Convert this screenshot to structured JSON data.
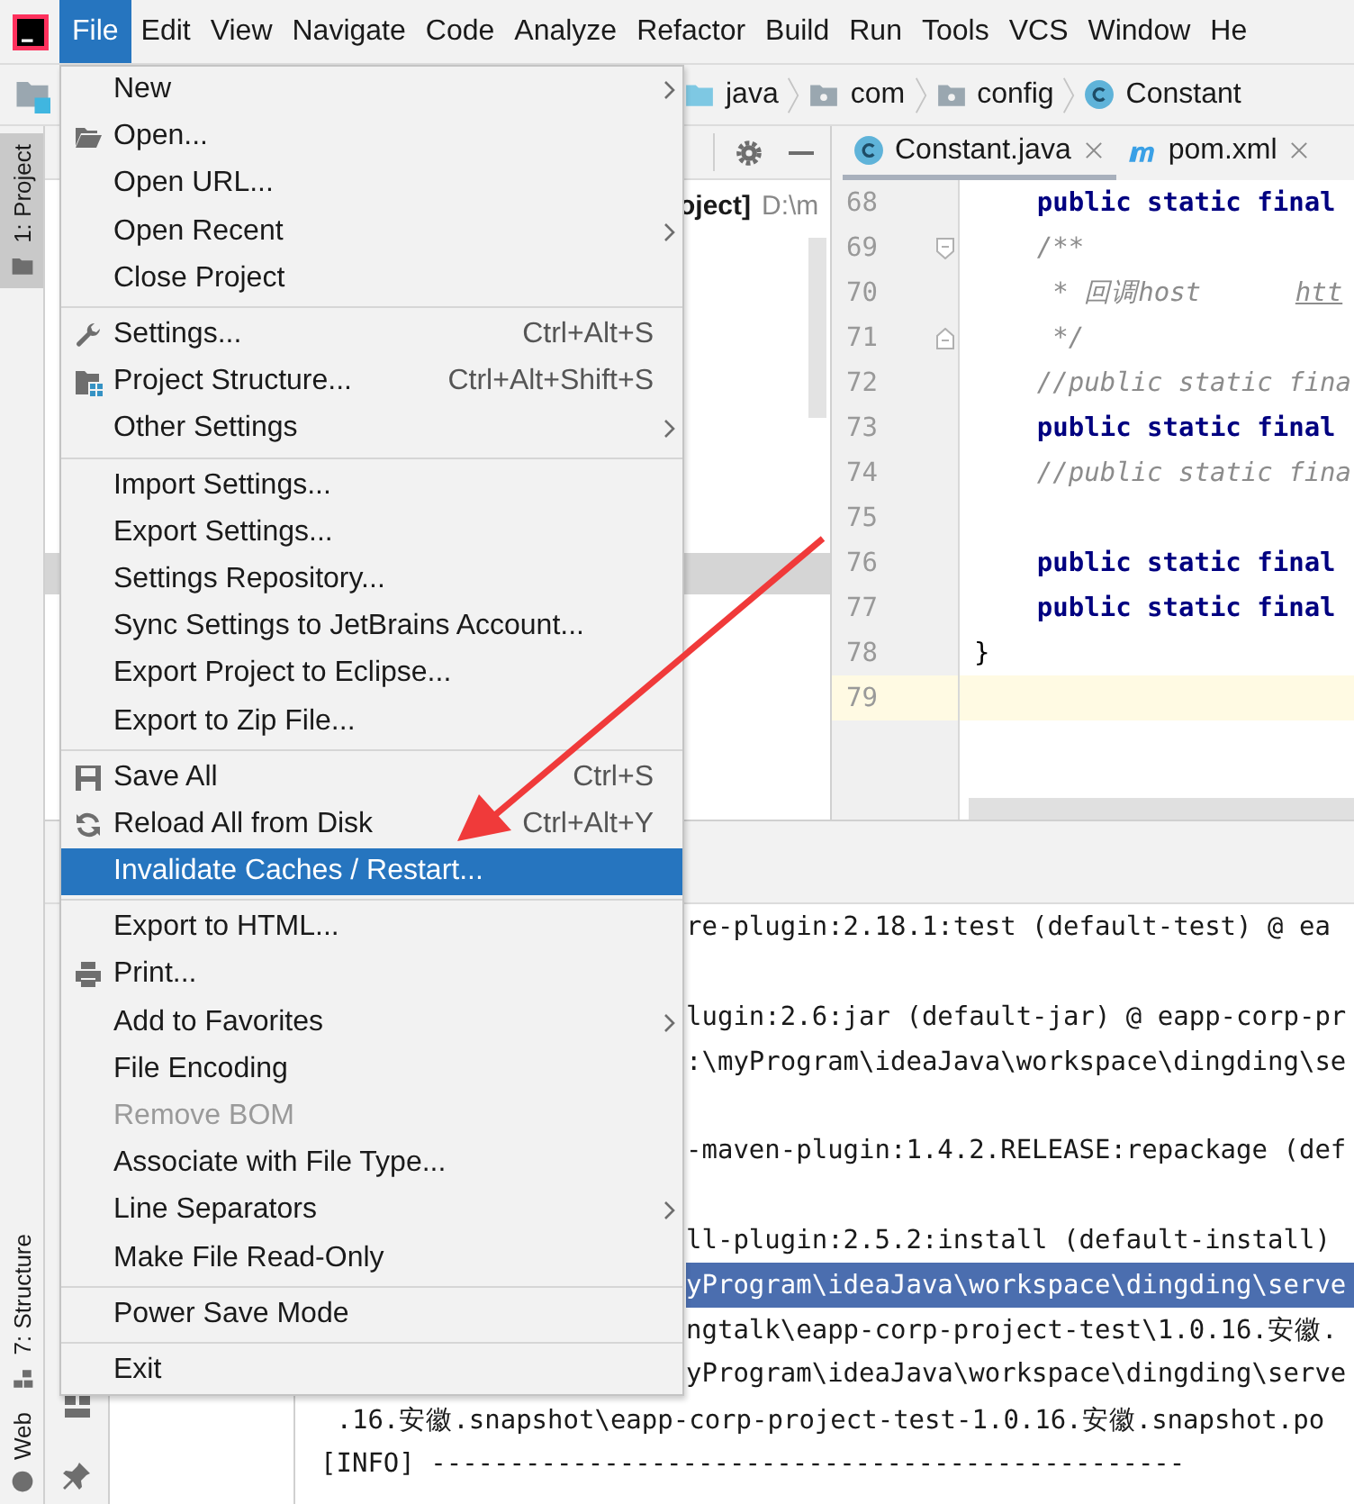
{
  "menubar": [
    {
      "label": "File",
      "selected": true
    },
    {
      "label": "Edit",
      "selected": false
    },
    {
      "label": "View",
      "selected": false
    },
    {
      "label": "Navigate",
      "selected": false
    },
    {
      "label": "Code",
      "selected": false
    },
    {
      "label": "Analyze",
      "selected": false
    },
    {
      "label": "Refactor",
      "selected": false
    },
    {
      "label": "Build",
      "selected": false
    },
    {
      "label": "Run",
      "selected": false
    },
    {
      "label": "Tools",
      "selected": false
    },
    {
      "label": "VCS",
      "selected": false
    },
    {
      "label": "Window",
      "selected": false
    },
    {
      "label": "He",
      "selected": false
    }
  ],
  "breadcrumb": [
    {
      "label": "java",
      "kind": "source-folder"
    },
    {
      "label": "com",
      "kind": "package"
    },
    {
      "label": "config",
      "kind": "package"
    },
    {
      "label": "Constant",
      "kind": "class"
    }
  ],
  "tool_stripes": [
    {
      "label": "1: Project",
      "kind": "project",
      "selected": true
    },
    {
      "label": "7: Structure",
      "kind": "structure",
      "selected": false
    },
    {
      "label": "Web",
      "kind": "web",
      "selected": false
    }
  ],
  "project_panel": {
    "root_name": "oject]",
    "root_path": "D:\\m"
  },
  "editor": {
    "tabs": [
      {
        "label": "Constant.java",
        "kind": "class",
        "selected": true
      },
      {
        "label": "pom.xml",
        "kind": "maven",
        "selected": false
      }
    ],
    "lines": [
      {
        "number": "68",
        "current": false,
        "segments": [
          {
            "text": "    public static final",
            "kind": "keyword"
          }
        ]
      },
      {
        "number": "69",
        "current": false,
        "segments": [
          {
            "text": "    /**",
            "kind": "doc"
          }
        ]
      },
      {
        "number": "70",
        "current": false,
        "segments": [
          {
            "text": "     * 回调host      ",
            "kind": "doc"
          },
          {
            "text": "htt",
            "kind": "link"
          }
        ]
      },
      {
        "number": "71",
        "current": false,
        "segments": [
          {
            "text": "     */",
            "kind": "doc"
          }
        ]
      },
      {
        "number": "72",
        "current": false,
        "segments": [
          {
            "text": "    //public static fina",
            "kind": "comment"
          }
        ]
      },
      {
        "number": "73",
        "current": false,
        "segments": [
          {
            "text": "    public static final",
            "kind": "keyword"
          }
        ]
      },
      {
        "number": "74",
        "current": false,
        "segments": [
          {
            "text": "    //public static fina",
            "kind": "comment"
          }
        ]
      },
      {
        "number": "75",
        "current": false
      },
      {
        "number": "76",
        "current": false,
        "segments": [
          {
            "text": "    public static final",
            "kind": "keyword"
          }
        ]
      },
      {
        "number": "77",
        "current": false,
        "segments": [
          {
            "text": "    public static final",
            "kind": "keyword"
          }
        ]
      },
      {
        "number": "78",
        "current": false,
        "segments": [
          {
            "text": "}",
            "kind": "plain"
          }
        ]
      },
      {
        "number": "79",
        "current": true
      }
    ]
  },
  "console": {
    "lines": [
      {
        "text": "re-plugin:2.18.1:test (default-test) @ ea",
        "kind": "covered",
        "selected": false
      },
      {
        "kind": "blank"
      },
      {
        "text": "lugin:2.6:jar (default-jar) @ eapp-corp-pr",
        "kind": "covered",
        "selected": false
      },
      {
        "text": ":\\myProgram\\ideaJava\\workspace\\dingding\\se",
        "kind": "covered",
        "selected": false
      },
      {
        "kind": "blank"
      },
      {
        "text": "-maven-plugin:1.4.2.RELEASE:repackage (def",
        "kind": "covered",
        "selected": false
      },
      {
        "kind": "blank"
      },
      {
        "text": "ll-plugin:2.5.2:install (default-install)",
        "kind": "covered",
        "selected": false
      },
      {
        "text": "yProgram\\ideaJava\\workspace\\dingding\\serve",
        "kind": "covered",
        "selected": true
      },
      {
        "text": "ngtalk\\eapp-corp-project-test\\1.0.16.安徽.",
        "kind": "covered",
        "selected": false
      },
      {
        "text": "yProgram\\ideaJava\\workspace\\dingding\\serve",
        "kind": "covered",
        "selected": false
      },
      {
        "text": " .16.安徽.snapshot\\eapp-corp-project-test-1.0.16.安徽.snapshot.po",
        "kind": "full",
        "selected": false
      },
      {
        "text": "[INFO] ------------------------------------------------",
        "kind": "full",
        "selected": false
      }
    ]
  },
  "file_menu": {
    "items": [
      {
        "kind": "item",
        "label": "New",
        "submenu": true,
        "selected": false,
        "disabled": false
      },
      {
        "kind": "item",
        "label": "Open...",
        "selected": false,
        "disabled": false
      },
      {
        "kind": "item",
        "label": "Open URL...",
        "selected": false,
        "disabled": false
      },
      {
        "kind": "item",
        "label": "Open Recent",
        "submenu": true,
        "selected": false,
        "disabled": false
      },
      {
        "kind": "item",
        "label": "Close Project",
        "selected": false,
        "disabled": false
      },
      {
        "kind": "separator"
      },
      {
        "kind": "item",
        "label": "Settings...",
        "shortcut": "Ctrl+Alt+S",
        "selected": false,
        "disabled": false
      },
      {
        "kind": "item",
        "label": "Project Structure...",
        "shortcut": "Ctrl+Alt+Shift+S",
        "selected": false,
        "disabled": false
      },
      {
        "kind": "item",
        "label": "Other Settings",
        "submenu": true,
        "selected": false,
        "disabled": false
      },
      {
        "kind": "separator"
      },
      {
        "kind": "item",
        "label": "Import Settings...",
        "selected": false,
        "disabled": false
      },
      {
        "kind": "item",
        "label": "Export Settings...",
        "selected": false,
        "disabled": false
      },
      {
        "kind": "item",
        "label": "Settings Repository...",
        "selected": false,
        "disabled": false
      },
      {
        "kind": "item",
        "label": "Sync Settings to JetBrains Account...",
        "selected": false,
        "disabled": false
      },
      {
        "kind": "item",
        "label": "Export Project to Eclipse...",
        "selected": false,
        "disabled": false
      },
      {
        "kind": "item",
        "label": "Export to Zip File...",
        "selected": false,
        "disabled": false
      },
      {
        "kind": "separator"
      },
      {
        "kind": "item",
        "label": "Save All",
        "shortcut": "Ctrl+S",
        "selected": false,
        "disabled": false
      },
      {
        "kind": "item",
        "label": "Reload All from Disk",
        "shortcut": "Ctrl+Alt+Y",
        "selected": false,
        "disabled": false
      },
      {
        "kind": "item",
        "label": "Invalidate Caches / Restart...",
        "selected": true,
        "disabled": false
      },
      {
        "kind": "separator"
      },
      {
        "kind": "item",
        "label": "Export to HTML...",
        "selected": false,
        "disabled": false
      },
      {
        "kind": "item",
        "label": "Print...",
        "selected": false,
        "disabled": false
      },
      {
        "kind": "item",
        "label": "Add to Favorites",
        "submenu": true,
        "selected": false,
        "disabled": false
      },
      {
        "kind": "item",
        "label": "File Encoding",
        "selected": false,
        "disabled": false
      },
      {
        "kind": "item",
        "label": "Remove BOM",
        "selected": false,
        "disabled": true
      },
      {
        "kind": "item",
        "label": "Associate with File Type...",
        "selected": false,
        "disabled": false
      },
      {
        "kind": "item",
        "label": "Line Separators",
        "submenu": true,
        "selected": false,
        "disabled": false
      },
      {
        "kind": "item",
        "label": "Make File Read-Only",
        "selected": false,
        "disabled": false
      },
      {
        "kind": "separator"
      },
      {
        "kind": "item",
        "label": "Power Save Mode",
        "selected": false,
        "disabled": false
      },
      {
        "kind": "separator"
      },
      {
        "kind": "item",
        "label": "Exit",
        "selected": false,
        "disabled": false
      }
    ]
  }
}
